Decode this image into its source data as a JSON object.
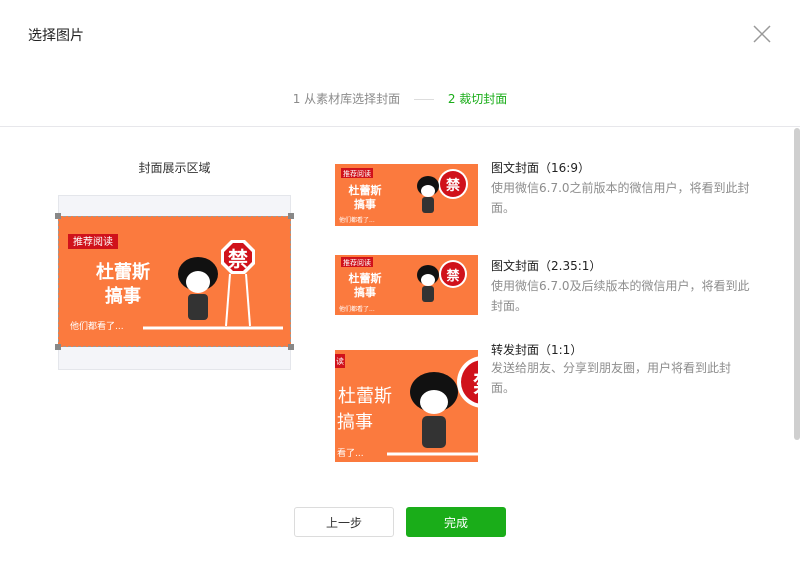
{
  "dialog": {
    "title": "选择图片",
    "close_icon": "close-icon"
  },
  "steps": {
    "step1": "1 从素材库选择封面",
    "step2": "2 裁切封面"
  },
  "preview": {
    "label": "封面展示区域"
  },
  "cover_art": {
    "badge": "推荐阅读",
    "line1": "杜蕾斯",
    "line2": "搞事",
    "bottom": "他们都看了...",
    "sign": "禁"
  },
  "covers": [
    {
      "title": "图文封面（16:9）",
      "desc": "使用微信6.7.0之前版本的微信用户，将看到此封面。"
    },
    {
      "title": "图文封面（2.35:1）",
      "desc": "使用微信6.7.0及后续版本的微信用户，将看到此封面。"
    },
    {
      "title": "转发封面（1:1）",
      "desc": "发送给朋友、分享到朋友圈，用户将看到此封面。"
    }
  ],
  "buttons": {
    "prev": "上一步",
    "done": "完成"
  },
  "colors": {
    "accent": "#1aad19",
    "cover_bg": "#fb7a3e",
    "sign_red": "#d0121b"
  }
}
